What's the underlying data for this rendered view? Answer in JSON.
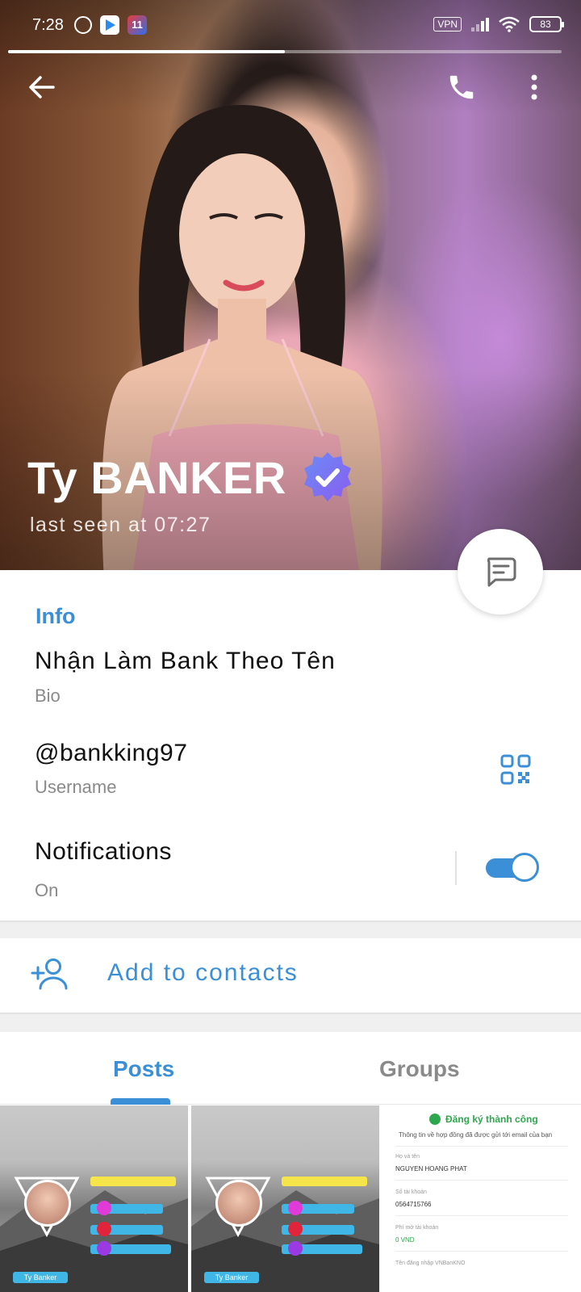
{
  "status_bar": {
    "time": "7:28",
    "vpn": "VPN",
    "battery": "83",
    "app_badge": "11"
  },
  "story": {
    "progress": 0.5
  },
  "profile": {
    "name": "Ty BANKER",
    "last_seen": "last seen at 07:27",
    "verified": true
  },
  "info": {
    "title": "Info",
    "bio": "Nhận Làm Bank Theo Tên",
    "bio_label": "Bio",
    "username": "@bankking97",
    "username_label": "Username",
    "notifications_title": "Notifications",
    "notifications_status": "On",
    "notifications_enabled": true
  },
  "actions": {
    "add_contact": "Add to contacts"
  },
  "tabs": [
    {
      "label": "Posts",
      "active": true
    },
    {
      "label": "Groups",
      "active": false
    }
  ],
  "media": {
    "promo_tile": {
      "name_tag": "Ty Banker"
    },
    "registration": {
      "title": "Đăng ký thành công",
      "subtitle": "Thông tin về hợp đồng đã được gửi tới email của bạn",
      "fields": [
        {
          "label": "Họ và tên",
          "value": "NGUYEN HOANG PHAT"
        },
        {
          "label": "Số tài khoản",
          "value": "0564715766"
        },
        {
          "label": "Phí mở tài khoản",
          "value": "0 VND"
        },
        {
          "label": "Tên đăng nhập VNBanKNO",
          "value": ""
        }
      ]
    }
  },
  "colors": {
    "accent": "#3a8fd6",
    "success": "#2ea84e",
    "secondary_text": "#8a8a8a"
  }
}
